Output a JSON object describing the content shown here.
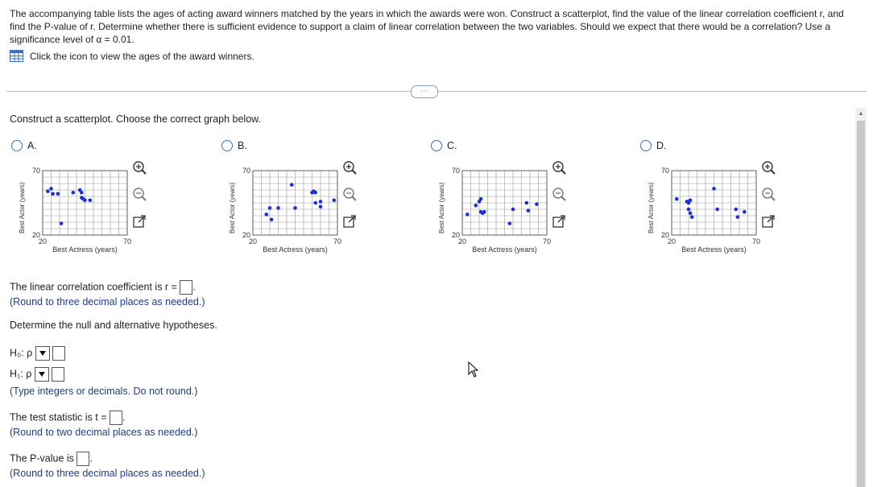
{
  "question": {
    "text": "The accompanying table lists the ages of acting award winners matched by the years in which the awards were won. Construct a scatterplot, find the value of the linear correlation coefficient r, and find the P-value of r. Determine whether there is sufficient evidence to support a claim of linear correlation between the two variables. Should we expect that there would be a correlation? Use a significance level of α = 0.01.",
    "link_label": "Click the icon to view the ages of the award winners."
  },
  "more_button": "⋯",
  "prompt": "Construct a scatterplot. Choose the correct graph below.",
  "options": [
    {
      "label": "A.",
      "y_axis": "Best Actor (years)",
      "x_axis": "Best Actress (years)",
      "x_min": "20",
      "x_max": "70",
      "y_min": "20",
      "y_max": "70",
      "points": [
        [
          23,
          54
        ],
        [
          25,
          56
        ],
        [
          26,
          52
        ],
        [
          29,
          52
        ],
        [
          31,
          29
        ],
        [
          38,
          53
        ],
        [
          42,
          55
        ],
        [
          43,
          53
        ],
        [
          43,
          49
        ],
        [
          44,
          48
        ],
        [
          45,
          47
        ],
        [
          48,
          47
        ]
      ]
    },
    {
      "label": "B.",
      "y_axis": "Best Actor (years)",
      "x_axis": "Best Actress (years)",
      "x_min": "20",
      "x_max": "70",
      "y_min": "20",
      "y_max": "70",
      "points": [
        [
          28,
          36
        ],
        [
          30,
          41
        ],
        [
          31,
          32
        ],
        [
          35,
          41
        ],
        [
          43,
          59
        ],
        [
          45,
          41
        ],
        [
          55,
          53
        ],
        [
          56,
          54
        ],
        [
          57,
          53
        ],
        [
          57,
          45
        ],
        [
          60,
          42
        ],
        [
          60,
          46
        ],
        [
          68,
          47
        ]
      ]
    },
    {
      "label": "C.",
      "y_axis": "Best Actor (years)",
      "x_axis": "Best Actress (years)",
      "x_min": "20",
      "x_max": "70",
      "y_min": "20",
      "y_max": "70",
      "points": [
        [
          23,
          36
        ],
        [
          28,
          43
        ],
        [
          30,
          46
        ],
        [
          31,
          48
        ],
        [
          31,
          38
        ],
        [
          32,
          37
        ],
        [
          33,
          38
        ],
        [
          48,
          29
        ],
        [
          50,
          40
        ],
        [
          58,
          45
        ],
        [
          59,
          39
        ],
        [
          64,
          44
        ]
      ]
    },
    {
      "label": "D.",
      "y_axis": "Best Actor (years)",
      "x_axis": "Best Actress (years)",
      "x_min": "20",
      "x_max": "70",
      "y_min": "20",
      "y_max": "70",
      "points": [
        [
          23,
          48
        ],
        [
          29,
          46
        ],
        [
          30,
          45
        ],
        [
          31,
          47
        ],
        [
          30,
          40
        ],
        [
          31,
          37
        ],
        [
          32,
          34
        ],
        [
          45,
          56
        ],
        [
          47,
          40
        ],
        [
          58,
          40
        ],
        [
          59,
          34
        ],
        [
          63,
          38
        ]
      ]
    }
  ],
  "r_label": "The linear correlation coefficient is r =",
  "r_hint": "(Round to three decimal places as needed.)",
  "hyp_prompt": "Determine the null and alternative hypotheses.",
  "h0_label": "H₀: ρ",
  "h1_label": "H₁: ρ",
  "hyp_hint": "(Type integers or decimals. Do not round.)",
  "t_label": "The test statistic is t =",
  "t_hint": "(Round to two decimal places as needed.)",
  "p_label": "The P-value is",
  "p_hint": "(Round to three decimal places as needed.)",
  "colors": {
    "accent": "#3a6fc4",
    "point": "#1a2fd6",
    "hint": "#1f3c88"
  }
}
